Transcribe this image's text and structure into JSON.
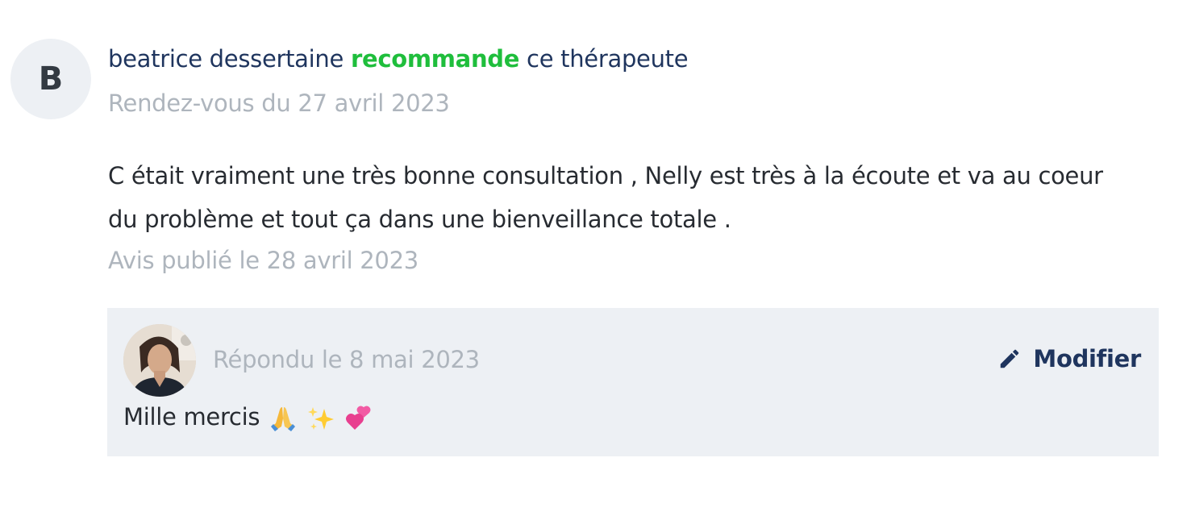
{
  "review": {
    "avatar_initial": "B",
    "author": "beatrice dessertaine",
    "recommend_word": "recommande",
    "recommend_suffix": "ce thérapeute",
    "appointment_date": "Rendez-vous du 27 avril 2023",
    "comment": "C était vraiment une très bonne consultation , Nelly est très à la écoute et va au coeur\ndu problème  et tout ça dans une bienveillance totale .",
    "published_date": "Avis publié le 28 avril 2023"
  },
  "reply": {
    "reply_date": "Répondu le 8 mai 2023",
    "edit_label": "Modifier",
    "text": "Mille mercis",
    "emojis": [
      "folded-hands-icon",
      "sparkles-icon",
      "two-hearts-icon"
    ]
  },
  "colors": {
    "author": "#1f355e",
    "recommend": "#1fbe3c",
    "muted": "#aeb5bd",
    "reply_background": "#edf0f4",
    "body_text": "#272b31"
  }
}
